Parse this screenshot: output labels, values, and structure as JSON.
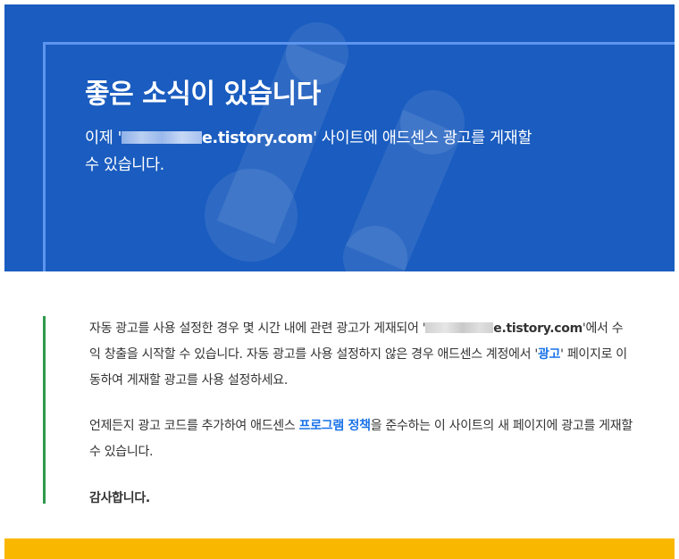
{
  "hero": {
    "title": "좋은 소식이 있습니다",
    "text_before": "이제 '",
    "site_domain": "e.tistory.com",
    "text_after": "' 사이트에 애드센스 광고를 게재할 수 있습니다."
  },
  "body": {
    "p1_before": "자동 광고를 사용 설정한 경우 몇 시간 내에 관련 광고가 게재되어 '",
    "site_domain": "e.tistory.com",
    "p1_middle": "'에서 수익 창출을 시작할 수 있습니다. 자동 광고를 사용 설정하지 않은 경우 애드센스 계정에서 '",
    "ads_link": "광고",
    "p1_after": "' 페이지로 이동하여 게재할 광고를 사용 설정하세요.",
    "p2_before": "언제든지 광고 코드를 추가하여 애드센스 ",
    "policy_link": "프로그램 정책",
    "p2_after": "을 준수하는 이 사이트의 새 페이지에 광고를 게재할 수 있습니다.",
    "closing": "감사합니다."
  },
  "colors": {
    "hero_background": "#1a5cbf",
    "hero_frame": "#5d95ee",
    "accent_green": "#2e9a4b",
    "footer_yellow": "#f9b700",
    "link_blue": "#1a73e8"
  },
  "icons": {
    "hero_watermark": "adsense-logo-icon"
  }
}
